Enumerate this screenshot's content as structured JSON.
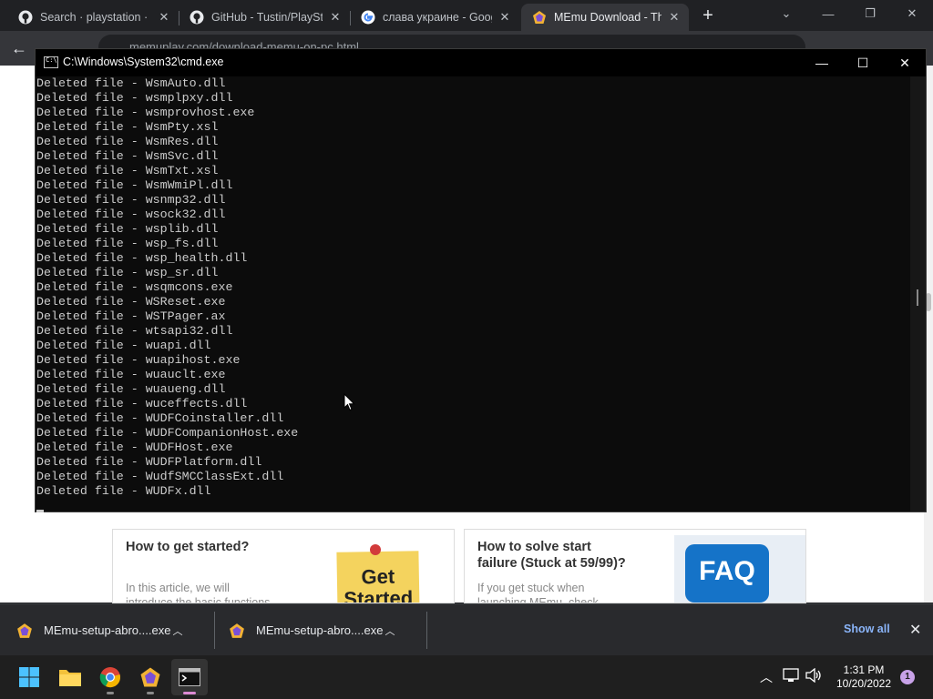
{
  "browser": {
    "tabs": [
      {
        "title": "Search · playstation · G",
        "favicon": "github-icon"
      },
      {
        "title": "GitHub - Tustin/PlaySta",
        "favicon": "github-icon"
      },
      {
        "title": "слава украине - Goog",
        "favicon": "google-icon"
      },
      {
        "title": "MEmu Download - The",
        "favicon": "memu-icon",
        "active": true
      }
    ],
    "url": "memuplay.com/download-memu-on-pc.html"
  },
  "cmd": {
    "title": "C:\\Windows\\System32\\cmd.exe",
    "lines": [
      "Deleted file - WsmAuto.dll",
      "Deleted file - wsmplpxy.dll",
      "Deleted file - wsmprovhost.exe",
      "Deleted file - WsmPty.xsl",
      "Deleted file - WsmRes.dll",
      "Deleted file - WsmSvc.dll",
      "Deleted file - WsmTxt.xsl",
      "Deleted file - WsmWmiPl.dll",
      "Deleted file - wsnmp32.dll",
      "Deleted file - wsock32.dll",
      "Deleted file - wsplib.dll",
      "Deleted file - wsp_fs.dll",
      "Deleted file - wsp_health.dll",
      "Deleted file - wsp_sr.dll",
      "Deleted file - wsqmcons.exe",
      "Deleted file - WSReset.exe",
      "Deleted file - WSTPager.ax",
      "Deleted file - wtsapi32.dll",
      "Deleted file - wuapi.dll",
      "Deleted file - wuapihost.exe",
      "Deleted file - wuauclt.exe",
      "Deleted file - wuaueng.dll",
      "Deleted file - wuceffects.dll",
      "Deleted file - WUDFCoinstaller.dll",
      "Deleted file - WUDFCompanionHost.exe",
      "Deleted file - WUDFHost.exe",
      "Deleted file - WUDFPlatform.dll",
      "Deleted file - WudfSMCClassExt.dll",
      "Deleted file - WUDFx.dll"
    ]
  },
  "page": {
    "cards": [
      {
        "title": "How to get started?",
        "text_1": "In this article, we will",
        "text_2": "introduce the basic functions",
        "image_text_1": "Get",
        "image_text_2": "Started"
      },
      {
        "title_1": "How to solve start",
        "title_2": "failure (Stuck at 59/99)?",
        "text_1": "If you get stuck when",
        "text_2": "launching MEmu, check",
        "image_text": "FAQ"
      }
    ]
  },
  "downloads": {
    "items": [
      {
        "name": "MEmu-setup-abro....exe"
      },
      {
        "name": "MEmu-setup-abro....exe"
      }
    ],
    "show_all": "Show all"
  },
  "taskbar": {
    "time": "1:31 PM",
    "date": "10/20/2022",
    "notifications": "1"
  }
}
